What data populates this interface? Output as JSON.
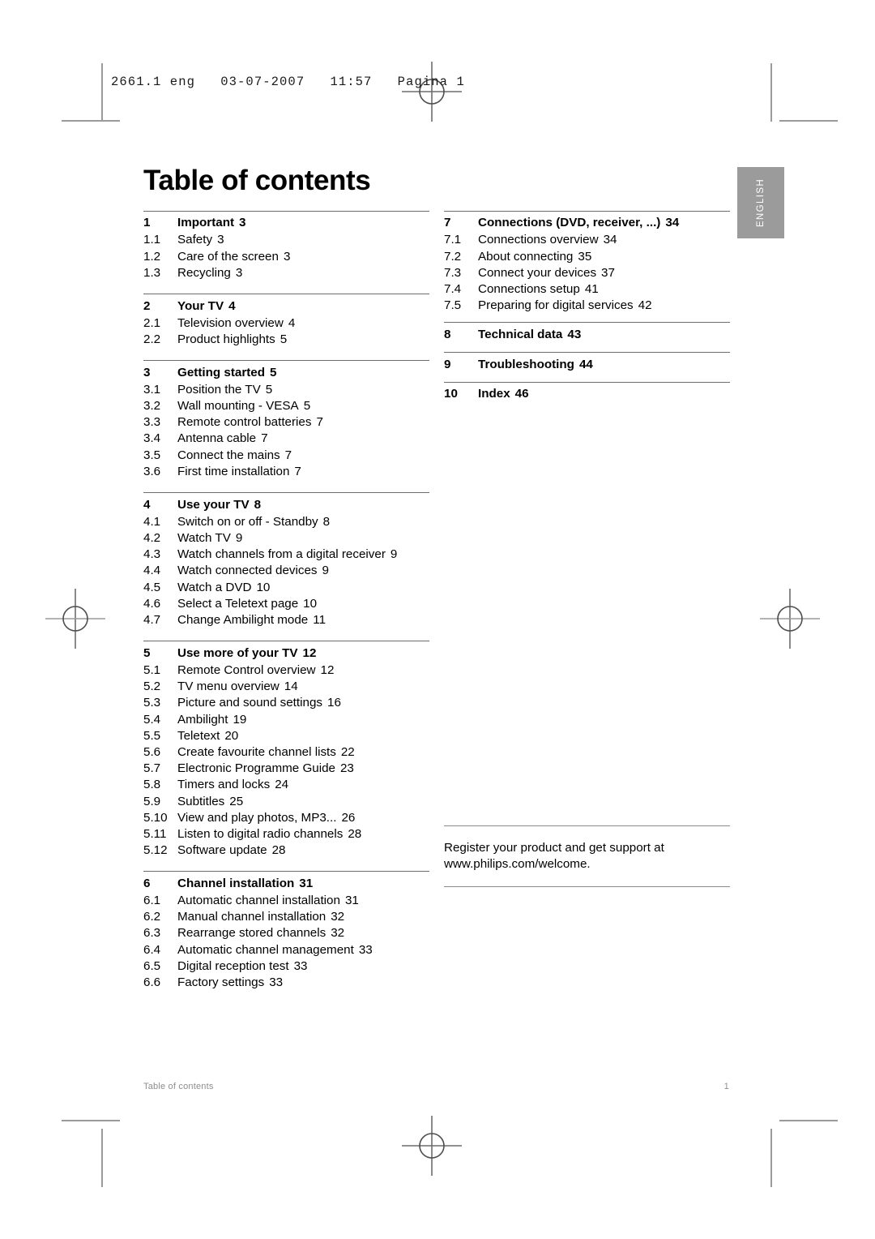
{
  "slug": {
    "text": "2661.1 eng   03-07-2007   11:57   Pagina 1"
  },
  "language_tab": {
    "label": "ENGLISH"
  },
  "page_title": "Table of contents",
  "footer": {
    "left": "Table of contents",
    "right": "1"
  },
  "register_note": {
    "line1": "Register your product and get support at",
    "line2": "www.philips.com/welcome."
  },
  "colors": {
    "rule": "#6d6d6d",
    "tab_background": "#9b9b9b",
    "tab_text": "#ffffff",
    "footer_text": "#8d8d8d",
    "crop_mark": "#9a9a9a"
  },
  "left_column": [
    {
      "number": "1",
      "title": "Important",
      "page": "3",
      "items": [
        {
          "number": "1.1",
          "title": "Safety",
          "page": "3"
        },
        {
          "number": "1.2",
          "title": "Care of the screen",
          "page": "3"
        },
        {
          "number": "1.3",
          "title": "Recycling",
          "page": "3"
        }
      ]
    },
    {
      "number": "2",
      "title": "Your TV",
      "page": "4",
      "items": [
        {
          "number": "2.1",
          "title": "Television overview",
          "page": "4"
        },
        {
          "number": "2.2",
          "title": "Product highlights",
          "page": "5"
        }
      ]
    },
    {
      "number": "3",
      "title": "Getting started",
      "page": "5",
      "items": [
        {
          "number": "3.1",
          "title": "Position the TV",
          "page": "5"
        },
        {
          "number": "3.2",
          "title": "Wall mounting - VESA",
          "page": "5"
        },
        {
          "number": "3.3",
          "title": "Remote control batteries",
          "page": "7"
        },
        {
          "number": "3.4",
          "title": "Antenna cable",
          "page": "7"
        },
        {
          "number": "3.5",
          "title": "Connect the mains",
          "page": "7"
        },
        {
          "number": "3.6",
          "title": "First time installation",
          "page": "7"
        }
      ]
    },
    {
      "number": "4",
      "title": "Use your TV",
      "page": "8",
      "items": [
        {
          "number": "4.1",
          "title": "Switch on or off - Standby",
          "page": "8"
        },
        {
          "number": "4.2",
          "title": "Watch TV",
          "page": "9"
        },
        {
          "number": "4.3",
          "title": "Watch channels from a digital receiver",
          "page": "9"
        },
        {
          "number": "4.4",
          "title": "Watch connected devices",
          "page": "9"
        },
        {
          "number": "4.5",
          "title": "Watch a DVD",
          "page": "10"
        },
        {
          "number": "4.6",
          "title": "Select a Teletext page",
          "page": "10"
        },
        {
          "number": "4.7",
          "title": "Change Ambilight mode",
          "page": "11"
        }
      ]
    },
    {
      "number": "5",
      "title": "Use more of your TV",
      "page": "12",
      "items": [
        {
          "number": "5.1",
          "title": "Remote Control overview",
          "page": "12"
        },
        {
          "number": "5.2",
          "title": "TV menu overview",
          "page": "14"
        },
        {
          "number": "5.3",
          "title": "Picture and sound settings",
          "page": "16"
        },
        {
          "number": "5.4",
          "title": "Ambilight",
          "page": "19"
        },
        {
          "number": "5.5",
          "title": "Teletext",
          "page": "20"
        },
        {
          "number": "5.6",
          "title": "Create favourite channel lists",
          "page": "22"
        },
        {
          "number": "5.7",
          "title": "Electronic Programme Guide",
          "page": "23"
        },
        {
          "number": "5.8",
          "title": "Timers and locks",
          "page": "24"
        },
        {
          "number": "5.9",
          "title": "Subtitles",
          "page": "25"
        },
        {
          "number": "5.10",
          "title": "View and play photos, MP3...",
          "page": "26"
        },
        {
          "number": "5.11",
          "title": "Listen to digital radio channels",
          "page": "28"
        },
        {
          "number": "5.12",
          "title": "Software update",
          "page": "28"
        }
      ]
    },
    {
      "number": "6",
      "title": "Channel installation",
      "page": "31",
      "items": [
        {
          "number": "6.1",
          "title": "Automatic channel installation",
          "page": "31"
        },
        {
          "number": "6.2",
          "title": "Manual channel installation",
          "page": "32"
        },
        {
          "number": "6.3",
          "title": "Rearrange stored channels",
          "page": "32"
        },
        {
          "number": "6.4",
          "title": "Automatic channel management",
          "page": "33"
        },
        {
          "number": "6.5",
          "title": "Digital reception test",
          "page": "33"
        },
        {
          "number": "6.6",
          "title": "Factory settings",
          "page": "33"
        }
      ]
    }
  ],
  "right_column": [
    {
      "number": "7",
      "title": "Connections (DVD, receiver, ...)",
      "page": "34",
      "items": [
        {
          "number": "7.1",
          "title": "Connections overview",
          "page": "34"
        },
        {
          "number": "7.2",
          "title": "About connecting",
          "page": "35"
        },
        {
          "number": "7.3",
          "title": "Connect your devices",
          "page": "37"
        },
        {
          "number": "7.4",
          "title": "Connections setup",
          "page": "41"
        },
        {
          "number": "7.5",
          "title": "Preparing for digital services",
          "page": "42"
        }
      ]
    },
    {
      "number": "8",
      "title": "Technical data",
      "page": "43",
      "items": []
    },
    {
      "number": "9",
      "title": "Troubleshooting",
      "page": "44",
      "items": []
    },
    {
      "number": "10",
      "title": "Index",
      "page": "46",
      "items": []
    }
  ]
}
